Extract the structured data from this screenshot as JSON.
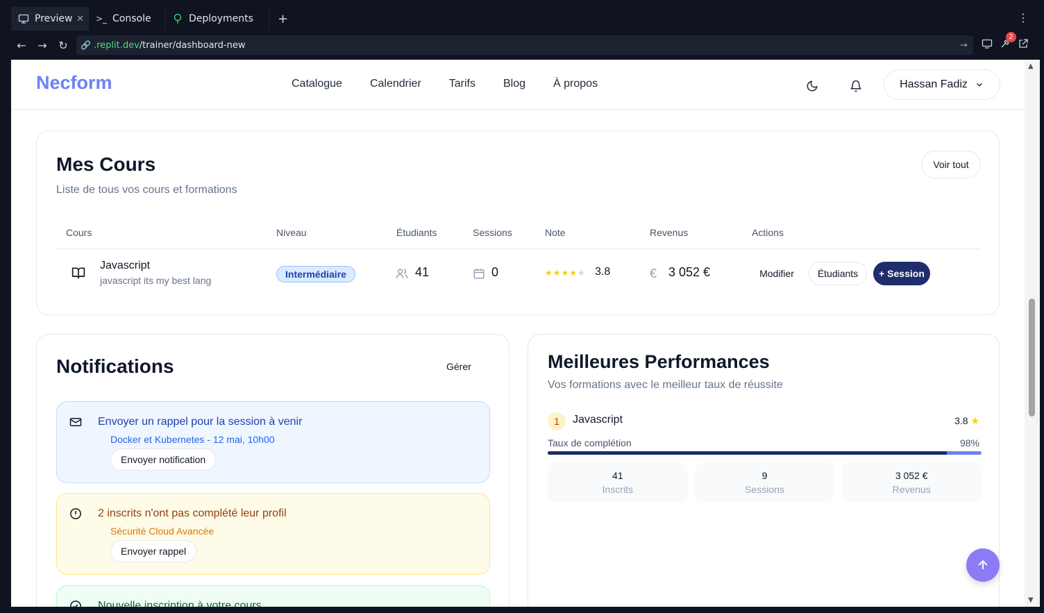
{
  "browser": {
    "tabs": [
      {
        "label": "Preview",
        "icon": "monitor-icon"
      },
      {
        "label": "Console",
        "icon": "terminal-icon"
      },
      {
        "label": "Deployments",
        "icon": "deploy-icon"
      }
    ],
    "url_domain": ".replit.dev",
    "url_path": "/trainer/dashboard-new",
    "notification_count": "2"
  },
  "app": {
    "logo": "Necform",
    "menu": [
      "Catalogue",
      "Calendrier",
      "Tarifs",
      "Blog",
      "À propos"
    ],
    "user_name": "Hassan Fadiz",
    "accent_color": "#6b82f4",
    "primary_color": "#1e2d6b"
  },
  "courses": {
    "title": "Mes Cours",
    "subtitle": "Liste de tous vos cours et formations",
    "view_all": "Voir tout",
    "headers": [
      "Cours",
      "Niveau",
      "Étudiants",
      "Sessions",
      "Note",
      "Revenus",
      "Actions"
    ],
    "rows": [
      {
        "name": "Javascript",
        "description": "javascript its my best lang",
        "level": "Intermédiaire",
        "students": "41",
        "sessions": "0",
        "stars": 4,
        "rating": "3.8",
        "revenue": "3 052 €",
        "actions": [
          "Modifier",
          "Étudiants",
          "+ Session"
        ]
      }
    ]
  },
  "notifications": {
    "title": "Notifications",
    "manage": "Gérer",
    "items": [
      {
        "title": "Envoyer un rappel pour la session à venir",
        "detail": "Docker et Kubernetes - 12 mai, 10h00",
        "action": "Envoyer notification",
        "icon": "mail-icon"
      },
      {
        "title": "2 inscrits n'ont pas complété leur profil",
        "detail": "Sécurité Cloud Avancée",
        "action": "Envoyer rappel",
        "icon": "alert-circle-icon"
      },
      {
        "title": "Nouvelle inscription à votre cours",
        "icon": "check-circle-icon"
      }
    ]
  },
  "performance": {
    "title": "Meilleures Performances",
    "subtitle": "Vos formations avec le meilleur taux de réussite",
    "top": {
      "rank": "1",
      "name": "Javascript",
      "rating": "3.8",
      "completion_label": "Taux de complétion",
      "completion_text": "98%",
      "completion_value": 0.92,
      "stats": [
        {
          "value": "41",
          "label": "Inscrits"
        },
        {
          "value": "9",
          "label": "Sessions"
        },
        {
          "value": "3 052 €",
          "label": "Revenus"
        }
      ]
    }
  }
}
